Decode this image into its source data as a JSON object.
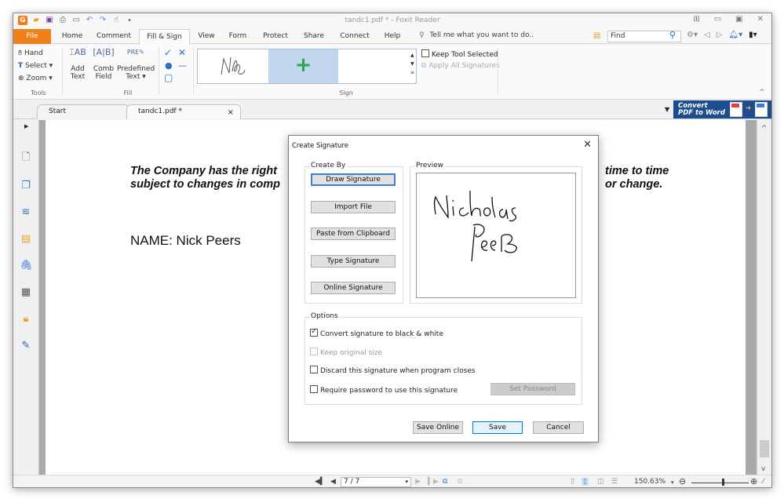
{
  "window": {
    "title": "tandc1.pdf * - Foxit Reader",
    "quick_access_icons": [
      "app-logo-icon",
      "open-folder-icon",
      "save-icon",
      "print-icon",
      "screen-icon",
      "undo-icon",
      "redo-icon",
      "hand-dropdown-icon",
      "customize-icon"
    ],
    "controls": [
      "tile-icon",
      "minimize-icon",
      "restore-icon",
      "close-icon"
    ]
  },
  "menu": {
    "tabs": [
      "File",
      "Home",
      "Comment",
      "Fill & Sign",
      "View",
      "Form",
      "Protect",
      "Share",
      "Connect",
      "Help"
    ],
    "active_tab": "Fill & Sign",
    "tell_me": "Tell me what you want to do..",
    "find_placeholder": "Find",
    "accent_color": "#f08019"
  },
  "ribbon": {
    "tools_group": {
      "label": "Tools",
      "items": [
        "Hand",
        "Select",
        "Zoom"
      ]
    },
    "fill_group": {
      "label": "Fill",
      "add_text": [
        "Add",
        "Text"
      ],
      "comb_field": [
        "Comb",
        "Field"
      ],
      "predefined_text": [
        "Predefined",
        "Text"
      ],
      "symbols": [
        "check-icon",
        "cross-icon",
        "dot-icon",
        "line-icon",
        "box-icon"
      ]
    },
    "sign_group": {
      "label": "Sign",
      "keep_tool_selected": "Keep Tool Selected",
      "keep_tool_selected_checked": false,
      "apply_all_signatures": "Apply All Signatures"
    }
  },
  "doc_tabs": {
    "tabs": [
      {
        "label": "Start",
        "active": false
      },
      {
        "label": "tandc1.pdf *",
        "active": true
      }
    ],
    "banner": [
      "Convert",
      "PDF to Word"
    ],
    "banner_color": "#1e4d8f"
  },
  "sidenav": {
    "icons": [
      "bookmark-icon",
      "pages-icon",
      "layers-icon",
      "comments-icon",
      "attachments-icon",
      "signature-panel-icon",
      "security-icon",
      "digital-id-icon"
    ]
  },
  "document": {
    "line1_left": "The Company has the right",
    "line2_left": "subject to changes in comp",
    "line1_right": "time to time",
    "line2_right": "or change.",
    "name_line": "NAME: Nick Peers"
  },
  "dialog": {
    "title": "Create Signature",
    "create_by": {
      "legend": "Create By",
      "buttons": [
        "Draw Signature",
        "Import File",
        "Paste from Clipboard",
        "Type Signature",
        "Online Signature"
      ]
    },
    "preview": {
      "legend": "Preview",
      "signature_text": [
        "Nicholas",
        "Peers"
      ]
    },
    "options": {
      "legend": "Options",
      "items": [
        {
          "label": "Convert signature to black & white",
          "checked": true,
          "disabled": false
        },
        {
          "label": "Keep original size",
          "checked": false,
          "disabled": true
        },
        {
          "label": "Discard this signature when program closes",
          "checked": false,
          "disabled": false
        },
        {
          "label": "Require password to use this signature",
          "checked": false,
          "disabled": false
        }
      ],
      "set_password": "Set Password"
    },
    "buttons": {
      "save_online": "Save Online",
      "save": "Save",
      "cancel": "Cancel"
    }
  },
  "statusbar": {
    "page": "7 / 7",
    "zoom": "150.63%",
    "zoom_slider_fraction": 0.55
  }
}
